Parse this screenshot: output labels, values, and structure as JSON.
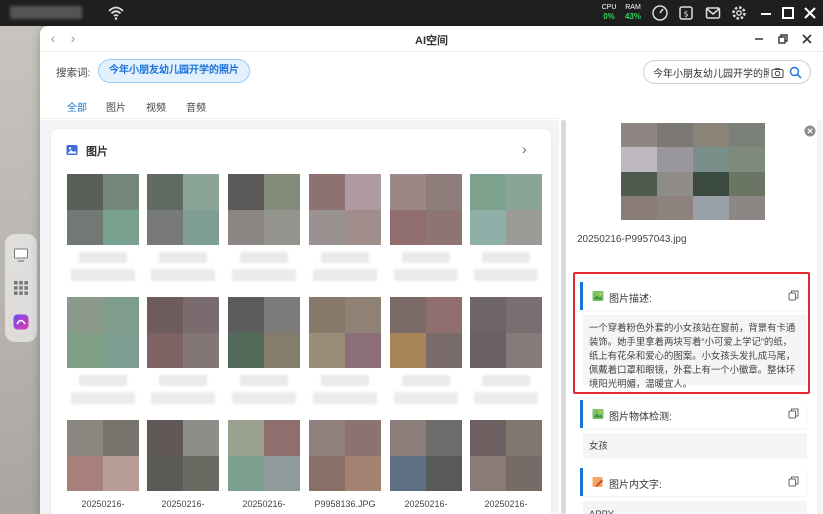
{
  "system_bar": {
    "cpu_label": "CPU",
    "cpu_value": "0%",
    "ram_label": "RAM",
    "ram_value": "43%",
    "icons": [
      "wifi-icon",
      "speedometer-icon",
      "clipboard-icon",
      "mail-icon",
      "gear-icon",
      "minimize-icon",
      "maximize-icon",
      "close-icon"
    ]
  },
  "window": {
    "title": "AI空间",
    "back_glyph": "‹",
    "forward_glyph": "›"
  },
  "search": {
    "label": "搜索词:",
    "chip": "今年小朋友幼儿园开学的照片",
    "value": "今年小朋友幼儿园开学的照",
    "placeholder": ""
  },
  "tabs": [
    "全部",
    "图片",
    "视频",
    "音频"
  ],
  "active_tab": 0,
  "section": {
    "title": "图片",
    "chevron": "›",
    "items": [
      {
        "colors": [
          "#5a5e58",
          "#74867a",
          "#727974",
          "#78a08e"
        ],
        "caption": ""
      },
      {
        "colors": [
          "#5f6b63",
          "#8aa497",
          "#777a77",
          "#7e9d93"
        ],
        "caption": ""
      },
      {
        "colors": [
          "#5c5a58",
          "#828a79",
          "#8b8584",
          "#93948e"
        ],
        "caption": ""
      },
      {
        "colors": [
          "#8d7270",
          "#b09aa1",
          "#9a9291",
          "#a18e8c"
        ],
        "caption": ""
      },
      {
        "colors": [
          "#9b8785",
          "#8d7e7c",
          "#8f6e6d",
          "#8e7473"
        ],
        "caption": ""
      },
      {
        "colors": [
          "#7fa28f",
          "#8aa595",
          "#8eafa7",
          "#9a9a96"
        ],
        "caption": ""
      },
      {
        "colors": [
          "#8b9a8b",
          "#7f9d8c",
          "#80a088",
          "#7d9d90"
        ],
        "caption": ""
      },
      {
        "colors": [
          "#6e5c5c",
          "#7a6b6e",
          "#7d6463",
          "#827776"
        ],
        "caption": ""
      },
      {
        "colors": [
          "#5b5d5c",
          "#7d7b7a",
          "#526a5a",
          "#857d6c"
        ],
        "caption": ""
      },
      {
        "colors": [
          "#887a6a",
          "#8f8274",
          "#9a8e7a",
          "#8b6e77"
        ],
        "caption": ""
      },
      {
        "colors": [
          "#7b6b68",
          "#8f6e6d",
          "#a88558",
          "#7a6b6b"
        ],
        "caption": ""
      },
      {
        "colors": [
          "#6d6568",
          "#7b6e70",
          "#6a5f63",
          "#867b7b"
        ],
        "caption": ""
      },
      {
        "colors": [
          "#8b857f",
          "#79736d",
          "#a77f7b",
          "#b89d97"
        ],
        "caption": "20250216-"
      },
      {
        "colors": [
          "#5f5857",
          "#8c8f87",
          "#5a5b56",
          "#6b6a62"
        ],
        "caption": "20250216-"
      },
      {
        "colors": [
          "#9aa18f",
          "#8f6f6e",
          "#7c9e8f",
          "#8f9a9b"
        ],
        "caption": "20250216-"
      },
      {
        "colors": [
          "#8f7f7d",
          "#8a7370",
          "#8a6f67",
          "#a48272"
        ],
        "caption": "P9958136.JPG"
      },
      {
        "colors": [
          "#8c7f7b",
          "#6e6c6a",
          "#5f6f86",
          "#575a56"
        ],
        "caption": "20250216-"
      },
      {
        "colors": [
          "#6e5f60",
          "#80776f",
          "#8a7b77",
          "#776b68"
        ],
        "caption": "20250216-"
      }
    ]
  },
  "detail": {
    "filename": "20250216-P9957043.jpg",
    "preview_colors": [
      "#8f8583",
      "#7c7975",
      "#8a8478",
      "#7b8079",
      "#bdb9bf",
      "#99969c",
      "#7a8f8a",
      "#7e8b7a",
      "#4d5a4e",
      "#8f8b88",
      "#3b4a3f",
      "#6b7563",
      "#8a7c78",
      "#8e827f",
      "#9aa0a8",
      "#8c8784"
    ],
    "sections": [
      {
        "title": "图片描述:",
        "body": "一个穿着粉色外套的小女孩站在窗前，背景有卡通装饰。她手里拿着两块写着“小可爱上学记”的纸，纸上有花朵和爱心的图案。小女孩头发扎成马尾，佩戴着口罩和眼镜，外套上有一个小徽章。整体环境阳光明媚，温暖宜人。"
      },
      {
        "title": "图片物体检测:",
        "body": "女孩"
      },
      {
        "title": "图片内文字:",
        "body": "APPY"
      }
    ]
  }
}
